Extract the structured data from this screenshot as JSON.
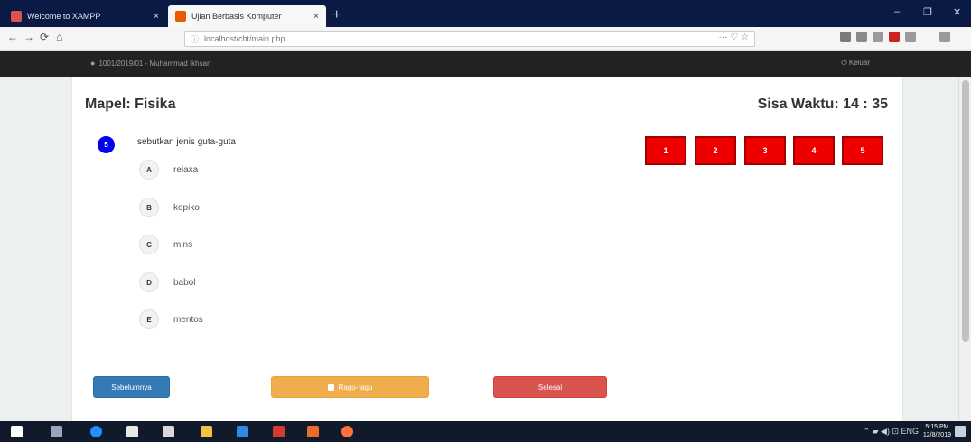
{
  "browser": {
    "tabs": [
      {
        "label": "Welcome to XAMPP",
        "close": "×"
      },
      {
        "label": "Ujian Berbasis Komputer",
        "close": "×"
      }
    ],
    "new_tab": "+",
    "window_controls": {
      "minimize": "–",
      "maximize": "❐",
      "close": "✕"
    },
    "nav": {
      "back": "←",
      "forward": "→",
      "reload": "⟳",
      "home": "⌂"
    },
    "url": "localhost/cbt/main.php",
    "url_actions": "··· ♡ ☆"
  },
  "header": {
    "user_icon": "user-icon",
    "user_text": "1001/2019/01 - Muhammad Ikhsan",
    "logout_text": "⏻ Keluar"
  },
  "exam": {
    "subject": "Mapel: Fisika",
    "timer": "Sisa Waktu: 14 : 35",
    "question_number": "5",
    "question_text": "sebutkan jenis guta-guta",
    "options": [
      {
        "letter": "A",
        "text": "relaxa"
      },
      {
        "letter": "B",
        "text": "kopiko"
      },
      {
        "letter": "C",
        "text": "mins"
      },
      {
        "letter": "D",
        "text": "babol"
      },
      {
        "letter": "E",
        "text": "mentos"
      }
    ],
    "navigator": [
      "1",
      "2",
      "3",
      "4",
      "5"
    ],
    "buttons": {
      "previous": "Sebelumnya",
      "doubt": "Ragu-ragu",
      "finish": "Selesai"
    }
  },
  "taskbar": {
    "tray": "⌃ ▰ ◀) ⊡ ENG",
    "time": "5:15 PM",
    "date": "12/8/2019"
  },
  "colors": {
    "question_badge": "#0000ee",
    "navigator_box": "#ee0000",
    "btn_previous": "#337ab7",
    "btn_doubt": "#f0ad4e",
    "btn_finish": "#d9534f",
    "header_bg": "#222222"
  }
}
